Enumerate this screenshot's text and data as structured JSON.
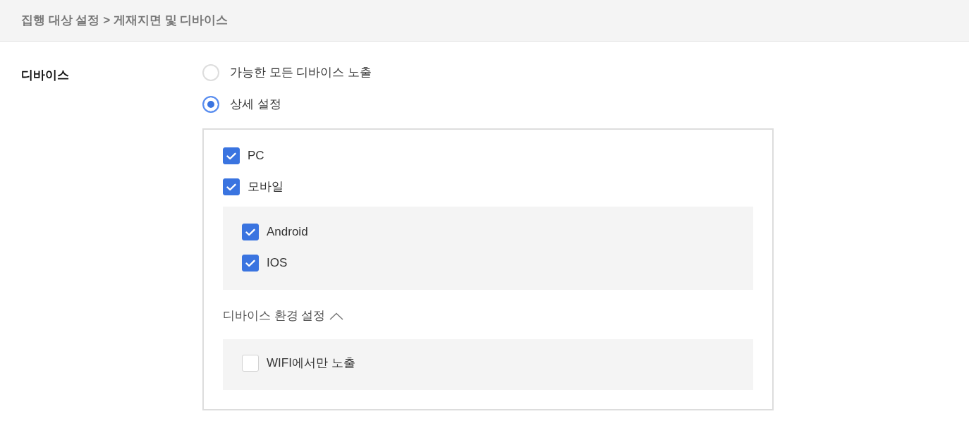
{
  "breadcrumb": "집행 대상 설정 > 게재지면 및 디바이스",
  "section": {
    "label": "디바이스",
    "options": [
      {
        "label": "가능한 모든 디바이스 노출",
        "selected": false
      },
      {
        "label": "상세 설정",
        "selected": true
      }
    ],
    "devices": [
      {
        "label": "PC",
        "checked": true
      },
      {
        "label": "모바일",
        "checked": true,
        "children": [
          {
            "label": "Android",
            "checked": true
          },
          {
            "label": "IOS",
            "checked": true
          }
        ]
      }
    ],
    "environment": {
      "title": "디바이스 환경 설정",
      "expanded": true,
      "options": [
        {
          "label": "WIFI에서만 노출",
          "checked": false
        }
      ]
    }
  }
}
